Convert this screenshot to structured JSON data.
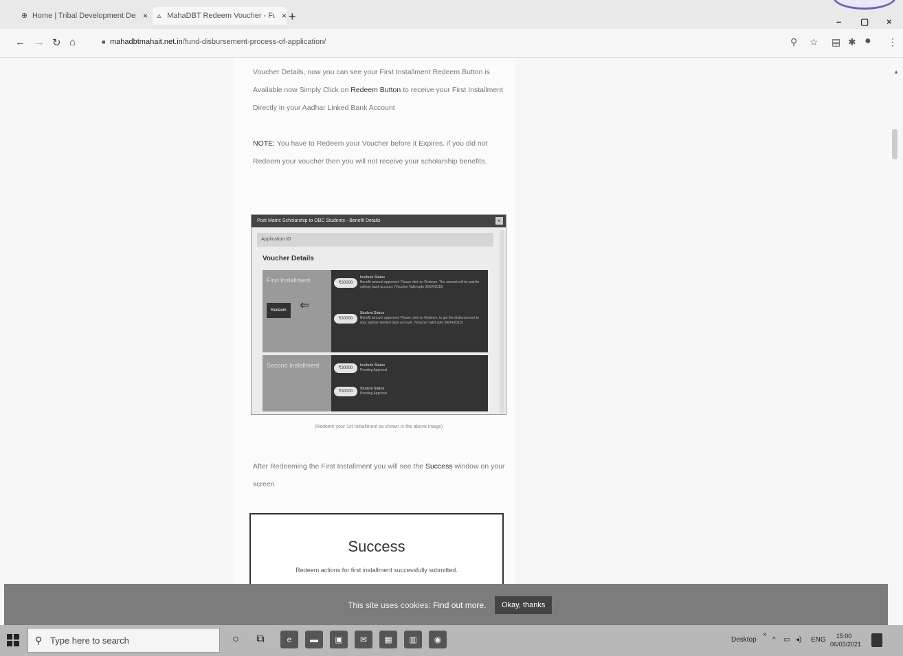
{
  "browser": {
    "tabs": [
      {
        "title": "Home | Tribal Development Dep..."
      },
      {
        "title": "MahaDBT Redeem Voucher - Fu..."
      }
    ],
    "new_tab": "+",
    "minimize": "–",
    "maximize": "▢",
    "close": "×",
    "url_domain": "mahadbtmahait.net.in",
    "url_path": "/fund-disbursement-process-of-application/"
  },
  "article": {
    "p1_pre": "Voucher Details, now you can see your First Installment Redeem Button is Available now Simply Click on ",
    "p1_strong": "Redeem Button",
    "p1_post": " to receive your First Installment Directly in your Aadhar Linked Bank Account",
    "p2_strong": "NOTE:",
    "p2_post": " You have to Redeem your Voucher before it Expires. if you did not Redeem your voucher then you will not receive your scholarship benefits.",
    "caption": "(Redeem your 1st Installment as shown in the above image)",
    "p3_pre": "After Redeeming the First Installment you will see the ",
    "p3_strong": "Success",
    "p3_post": " window on your screen",
    "success_title": "Success",
    "success_msg": "Redeem actions for first installment successfully submitted."
  },
  "embedded": {
    "title": "Post Matric Scholarship to OBC Students - Benefit Details",
    "close": "×",
    "app_id": "Application ID",
    "voucher_details": "Voucher Details",
    "first_installment": "First Installment",
    "second_installment": "Second Installment",
    "redeem": "Redeem",
    "pill": "₹30000",
    "inst_status": "Institute Status",
    "inst_text": "Benefit amount approved. Please click on Redeem. The amount will be paid to college bank account. (Voucher Valid upto 06/04/2019)",
    "stud_status": "Student Status",
    "stud_text": "Benefit amount approved. Please click on Redeem, to get the disbursement to your aadhar seeded bank account. (Voucher valid upto 06/04/2019)",
    "inst_status2": "Institute Status",
    "pending": "Pending Approval",
    "stud_status2": "Student Status",
    "pending2": "Pending Approval"
  },
  "cookie": {
    "text_pre": "This site uses cookies: ",
    "find_out": "Find out more.",
    "button": "Okay, thanks"
  },
  "taskbar": {
    "search_placeholder": "Type here to search",
    "desktop": "Desktop",
    "lang": "ENG",
    "time": "15:00",
    "date": "06/03/2021"
  }
}
